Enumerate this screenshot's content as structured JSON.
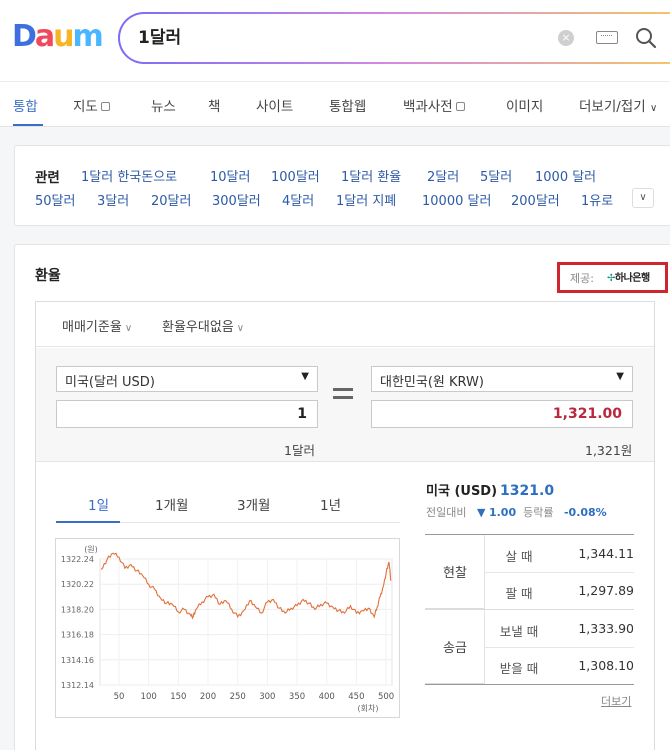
{
  "logo": {
    "letters": [
      "D",
      "a",
      "u",
      "m"
    ],
    "colors": [
      "#3d6fe0",
      "#f0495e",
      "#f6b524",
      "#49b6ff"
    ]
  },
  "search": {
    "query": "1달러"
  },
  "tabs": [
    {
      "label": "통합",
      "active": true,
      "box": false
    },
    {
      "label": "지도",
      "active": false,
      "box": true
    },
    {
      "label": "뉴스",
      "active": false,
      "box": false
    },
    {
      "label": "책",
      "active": false,
      "box": false
    },
    {
      "label": "사이트",
      "active": false,
      "box": false
    },
    {
      "label": "통합웹",
      "active": false,
      "box": false
    },
    {
      "label": "백과사전",
      "active": false,
      "box": true
    },
    {
      "label": "이미지",
      "active": false,
      "box": false
    },
    {
      "label": "더보기/접기",
      "active": false,
      "box": false
    }
  ],
  "related": {
    "title": "관련",
    "row1": [
      "1달러 한국돈으로",
      "10달러",
      "100달러",
      "1달러 환율",
      "2달러",
      "5달러",
      "1000 달러"
    ],
    "row2": [
      "50달러",
      "3달러",
      "20달러",
      "300달러",
      "4달러",
      "1달러 지폐",
      "10000 달러",
      "200달러",
      "1유로"
    ]
  },
  "exchange": {
    "title": "환율",
    "provider_label": "제공:",
    "provider_name": "하나은행",
    "options": [
      "매매기준율",
      "환율우대없음"
    ],
    "from_currency": "미국(달러 USD)",
    "to_currency": "대한민국(원 KRW)",
    "from_amount": "1",
    "to_amount": "1,321.00",
    "from_word": "1달러",
    "to_word": "1,321원",
    "periods": [
      "1일",
      "1개월",
      "3개월",
      "1년"
    ],
    "country_label": "미국 (USD)",
    "current_rate": "1321.0",
    "diff_label": "전일대비",
    "diff_arrow": "▼",
    "diff_value": "1.00",
    "rate_change_label": "등락률",
    "rate_change_value": "-0.08%",
    "groups": [
      {
        "name": "현찰",
        "rows": [
          {
            "label": "살 때",
            "value": "1,344.11"
          },
          {
            "label": "팔 때",
            "value": "1,297.89"
          }
        ]
      },
      {
        "name": "송금",
        "rows": [
          {
            "label": "보낼 때",
            "value": "1,333.90"
          },
          {
            "label": "받을 때",
            "value": "1,308.10"
          }
        ]
      }
    ],
    "more_label": "더보기"
  },
  "chart_data": {
    "type": "line",
    "unit_label": "(원)",
    "x_unit_label": "(회차)",
    "y_ticks": [
      "1322.24",
      "1320.22",
      "1318.20",
      "1316.18",
      "1314.16",
      "1312.14"
    ],
    "x_ticks": [
      "50",
      "100",
      "150",
      "200",
      "250",
      "300",
      "350",
      "400",
      "450",
      "500"
    ],
    "ylim": [
      1312.14,
      1322.24
    ],
    "xlim": [
      18,
      510
    ],
    "line_color": "#e0703a",
    "x": [
      20,
      30,
      40,
      50,
      60,
      70,
      80,
      90,
      100,
      110,
      120,
      130,
      140,
      150,
      160,
      170,
      175,
      180,
      190,
      200,
      210,
      220,
      230,
      240,
      250,
      260,
      270,
      280,
      290,
      300,
      310,
      320,
      330,
      340,
      350,
      360,
      370,
      380,
      390,
      400,
      410,
      420,
      430,
      440,
      450,
      460,
      470,
      480,
      485,
      490,
      495,
      500,
      505,
      508
    ],
    "values": [
      1321.4,
      1322.2,
      1322.7,
      1322.4,
      1321.5,
      1321.8,
      1321.3,
      1320.9,
      1320.2,
      1319.8,
      1319.1,
      1318.7,
      1318.6,
      1318.0,
      1318.2,
      1317.8,
      1317.6,
      1318.2,
      1318.8,
      1319.2,
      1319.4,
      1318.6,
      1318.9,
      1318.2,
      1317.6,
      1318.1,
      1318.9,
      1318.4,
      1317.9,
      1318.8,
      1319.0,
      1318.3,
      1317.9,
      1318.3,
      1318.5,
      1319.0,
      1318.7,
      1318.2,
      1318.6,
      1318.7,
      1318.4,
      1318.1,
      1317.9,
      1318.5,
      1317.9,
      1318.1,
      1318.3,
      1317.6,
      1318.4,
      1319.2,
      1320.0,
      1321.1,
      1322.0,
      1320.5
    ]
  }
}
